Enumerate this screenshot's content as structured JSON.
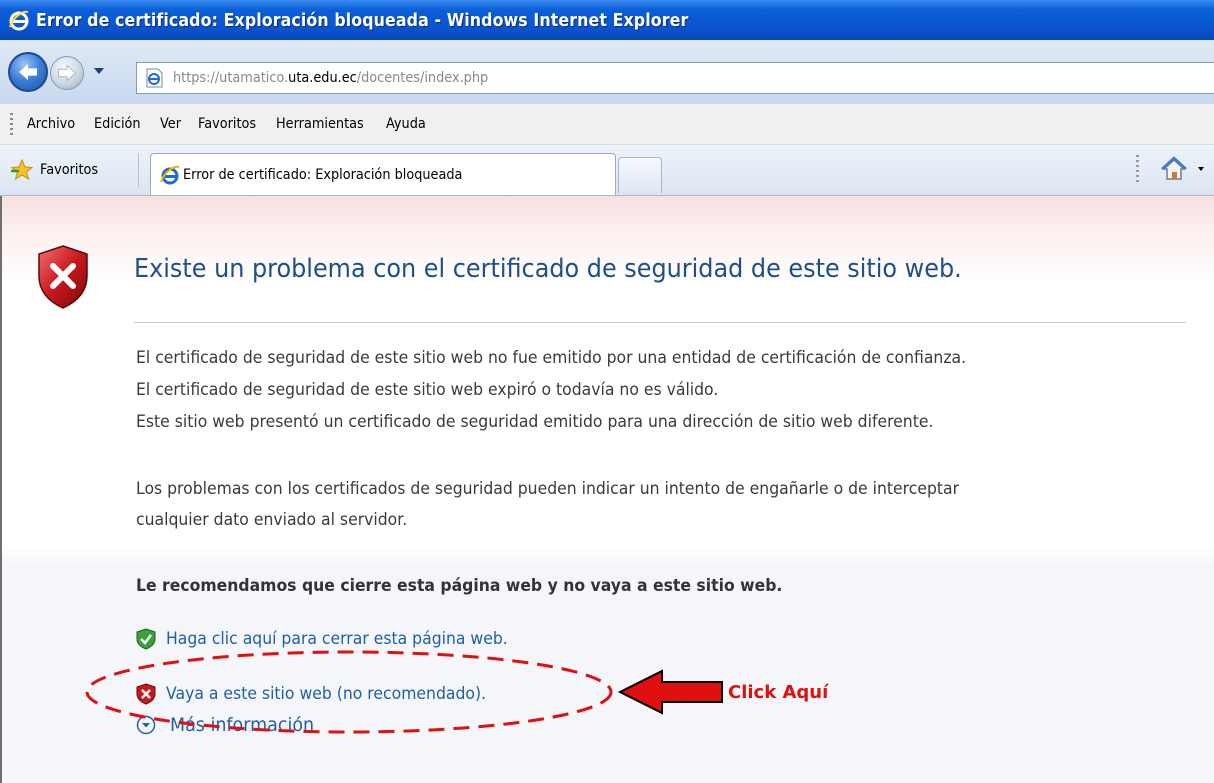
{
  "window": {
    "title": "Error de certificado: Exploración bloqueada - Windows Internet Explorer"
  },
  "address_bar": {
    "url_prefix": "https://utamatico.",
    "url_host": "uta.edu.ec",
    "url_path": "/docentes/index.php"
  },
  "menu": {
    "items": [
      "Archivo",
      "Edición",
      "Ver",
      "Favoritos",
      "Herramientas",
      "Ayuda"
    ]
  },
  "tabs_bar": {
    "favorites_label": "Favoritos",
    "active_tab_label": "Error de certificado: Exploración bloqueada"
  },
  "page": {
    "heading": "Existe un problema con el certificado de seguridad de este sitio web.",
    "reasons": [
      "El certificado de seguridad de este sitio web no fue emitido por una entidad de certificación de confianza.",
      "El certificado de seguridad de este sitio web expiró o todavía no es válido.",
      "Este sitio web presentó un certificado de seguridad emitido para una dirección de sitio web diferente."
    ],
    "warning_lines": [
      "Los problemas con los certificados de seguridad pueden indicar un intento de engañarle o de interceptar",
      "cualquier dato enviado al servidor."
    ],
    "recommendation": "Le recomendamos que cierre esta página web y no vaya a este sitio web.",
    "close_link": "Haga clic aquí para cerrar esta página web.",
    "continue_link": "Vaya a este sitio web (no recomendado).",
    "more_info": "Más información"
  },
  "annotation": {
    "label": "Click Aquí",
    "color": "#e01010"
  },
  "colors": {
    "titlebar": "#0a55d0",
    "heading": "#1f4f8a",
    "link": "#1f5fa8",
    "annotation": "#e01010"
  }
}
